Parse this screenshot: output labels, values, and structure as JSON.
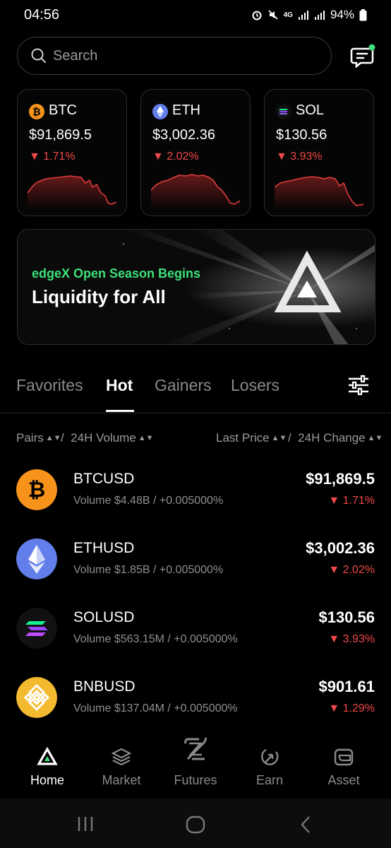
{
  "status_bar": {
    "time": "04:56",
    "battery": "94%",
    "network": "4G"
  },
  "search": {
    "placeholder": "Search"
  },
  "tickers": [
    {
      "symbol": "BTC",
      "price": "$91,869.5",
      "change": "1.71%",
      "icon": "btc-icon",
      "color": "#f7931a"
    },
    {
      "symbol": "ETH",
      "price": "$3,002.36",
      "change": "2.02%",
      "icon": "eth-icon",
      "color": "#627eea"
    },
    {
      "symbol": "SOL",
      "price": "$130.56",
      "change": "3.93%",
      "icon": "sol-icon",
      "color": "#9945ff"
    }
  ],
  "banner": {
    "subtitle": "edgeX Open Season Begins",
    "title": "Liquidity for All"
  },
  "tabs": [
    "Favorites",
    "Hot",
    "Gainers",
    "Losers"
  ],
  "active_tab": "Hot",
  "columns": {
    "pairs": "Pairs",
    "volume": "24H Volume",
    "last_price": "Last Price",
    "change": "24H Change"
  },
  "markets": [
    {
      "pair": "BTCUSD",
      "volume": "Volume $4.48B / +0.005000%",
      "price": "$91,869.5",
      "change": "1.71%"
    },
    {
      "pair": "ETHUSD",
      "volume": "Volume $1.85B / +0.005000%",
      "price": "$3,002.36",
      "change": "2.02%"
    },
    {
      "pair": "SOLUSD",
      "volume": "Volume $563.15M / +0.005000%",
      "price": "$130.56",
      "change": "3.93%"
    },
    {
      "pair": "BNBUSD",
      "volume": "Volume $137.04M / +0.005000%",
      "price": "$901.61",
      "change": "1.29%"
    }
  ],
  "nav": [
    "Home",
    "Market",
    "Futures",
    "Earn",
    "Asset"
  ],
  "active_nav": "Home",
  "colors": {
    "down": "#f04848",
    "accent_green": "#3ee07a",
    "background": "#000000"
  }
}
